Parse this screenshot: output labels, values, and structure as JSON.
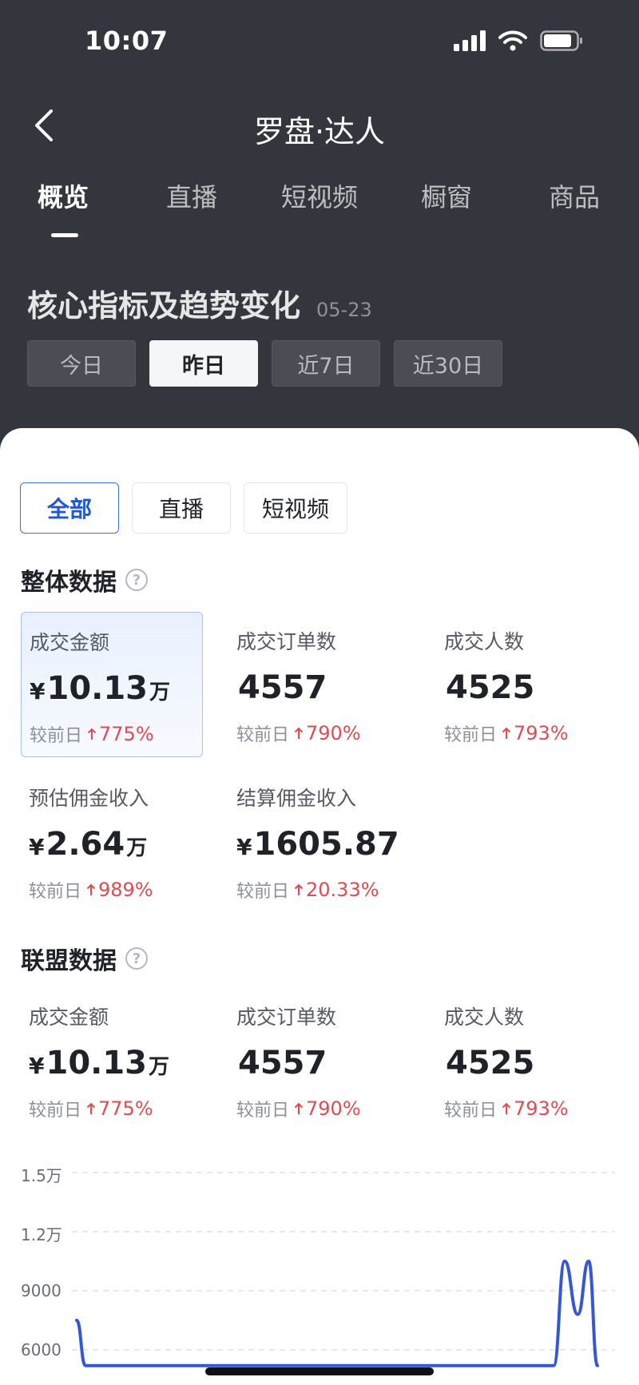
{
  "status": {
    "time": "10:07"
  },
  "nav": {
    "title": "罗盘·达人"
  },
  "tabs": [
    {
      "label": "概览",
      "active": true
    },
    {
      "label": "直播"
    },
    {
      "label": "短视频"
    },
    {
      "label": "橱窗"
    },
    {
      "label": "商品"
    }
  ],
  "section": {
    "title": "核心指标及趋势变化",
    "date": "05-23"
  },
  "periods": [
    "今日",
    "昨日",
    "近7日",
    "近30日"
  ],
  "active_period": "昨日",
  "filters": [
    "全部",
    "直播",
    "短视频"
  ],
  "active_filter": "全部",
  "overall": {
    "title": "整体数据",
    "metrics": [
      {
        "label": "成交金额",
        "currency": "¥",
        "value": "10.13",
        "unit": "万",
        "compare_label": "较前日",
        "change": "775%"
      },
      {
        "label": "成交订单数",
        "currency": "",
        "value": "4557",
        "unit": "",
        "compare_label": "较前日",
        "change": "790%"
      },
      {
        "label": "成交人数",
        "currency": "",
        "value": "4525",
        "unit": "",
        "compare_label": "较前日",
        "change": "793%"
      },
      {
        "label": "预估佣金收入",
        "currency": "¥",
        "value": "2.64",
        "unit": "万",
        "compare_label": "较前日",
        "change": "989%"
      },
      {
        "label": "结算佣金收入",
        "currency": "¥",
        "value": "1605.87",
        "unit": "",
        "compare_label": "较前日",
        "change": "20.33%"
      }
    ]
  },
  "alliance": {
    "title": "联盟数据",
    "metrics": [
      {
        "label": "成交金额",
        "currency": "¥",
        "value": "10.13",
        "unit": "万",
        "compare_label": "较前日",
        "change": "775%"
      },
      {
        "label": "成交订单数",
        "currency": "",
        "value": "4557",
        "unit": "",
        "compare_label": "较前日",
        "change": "790%"
      },
      {
        "label": "成交人数",
        "currency": "",
        "value": "4525",
        "unit": "",
        "compare_label": "较前日",
        "change": "793%"
      }
    ]
  },
  "chart_data": {
    "type": "line",
    "y_ticks": [
      "1.5万",
      "1.2万",
      "9000",
      "6000"
    ],
    "ylim": [
      6000,
      15000
    ],
    "series": [
      {
        "color": "#3656d8",
        "x": [
          0,
          0.4,
          21.8,
          22.3,
          22.9,
          23.4,
          23.8
        ],
        "y": [
          7500,
          5200,
          5200,
          10500,
          7800,
          10500,
          5200
        ]
      }
    ],
    "xlim": [
      0,
      23.8
    ],
    "grid": true
  },
  "colors": {
    "accent": "#2157d3",
    "up": "#e5484d",
    "line": "#3656d8"
  }
}
